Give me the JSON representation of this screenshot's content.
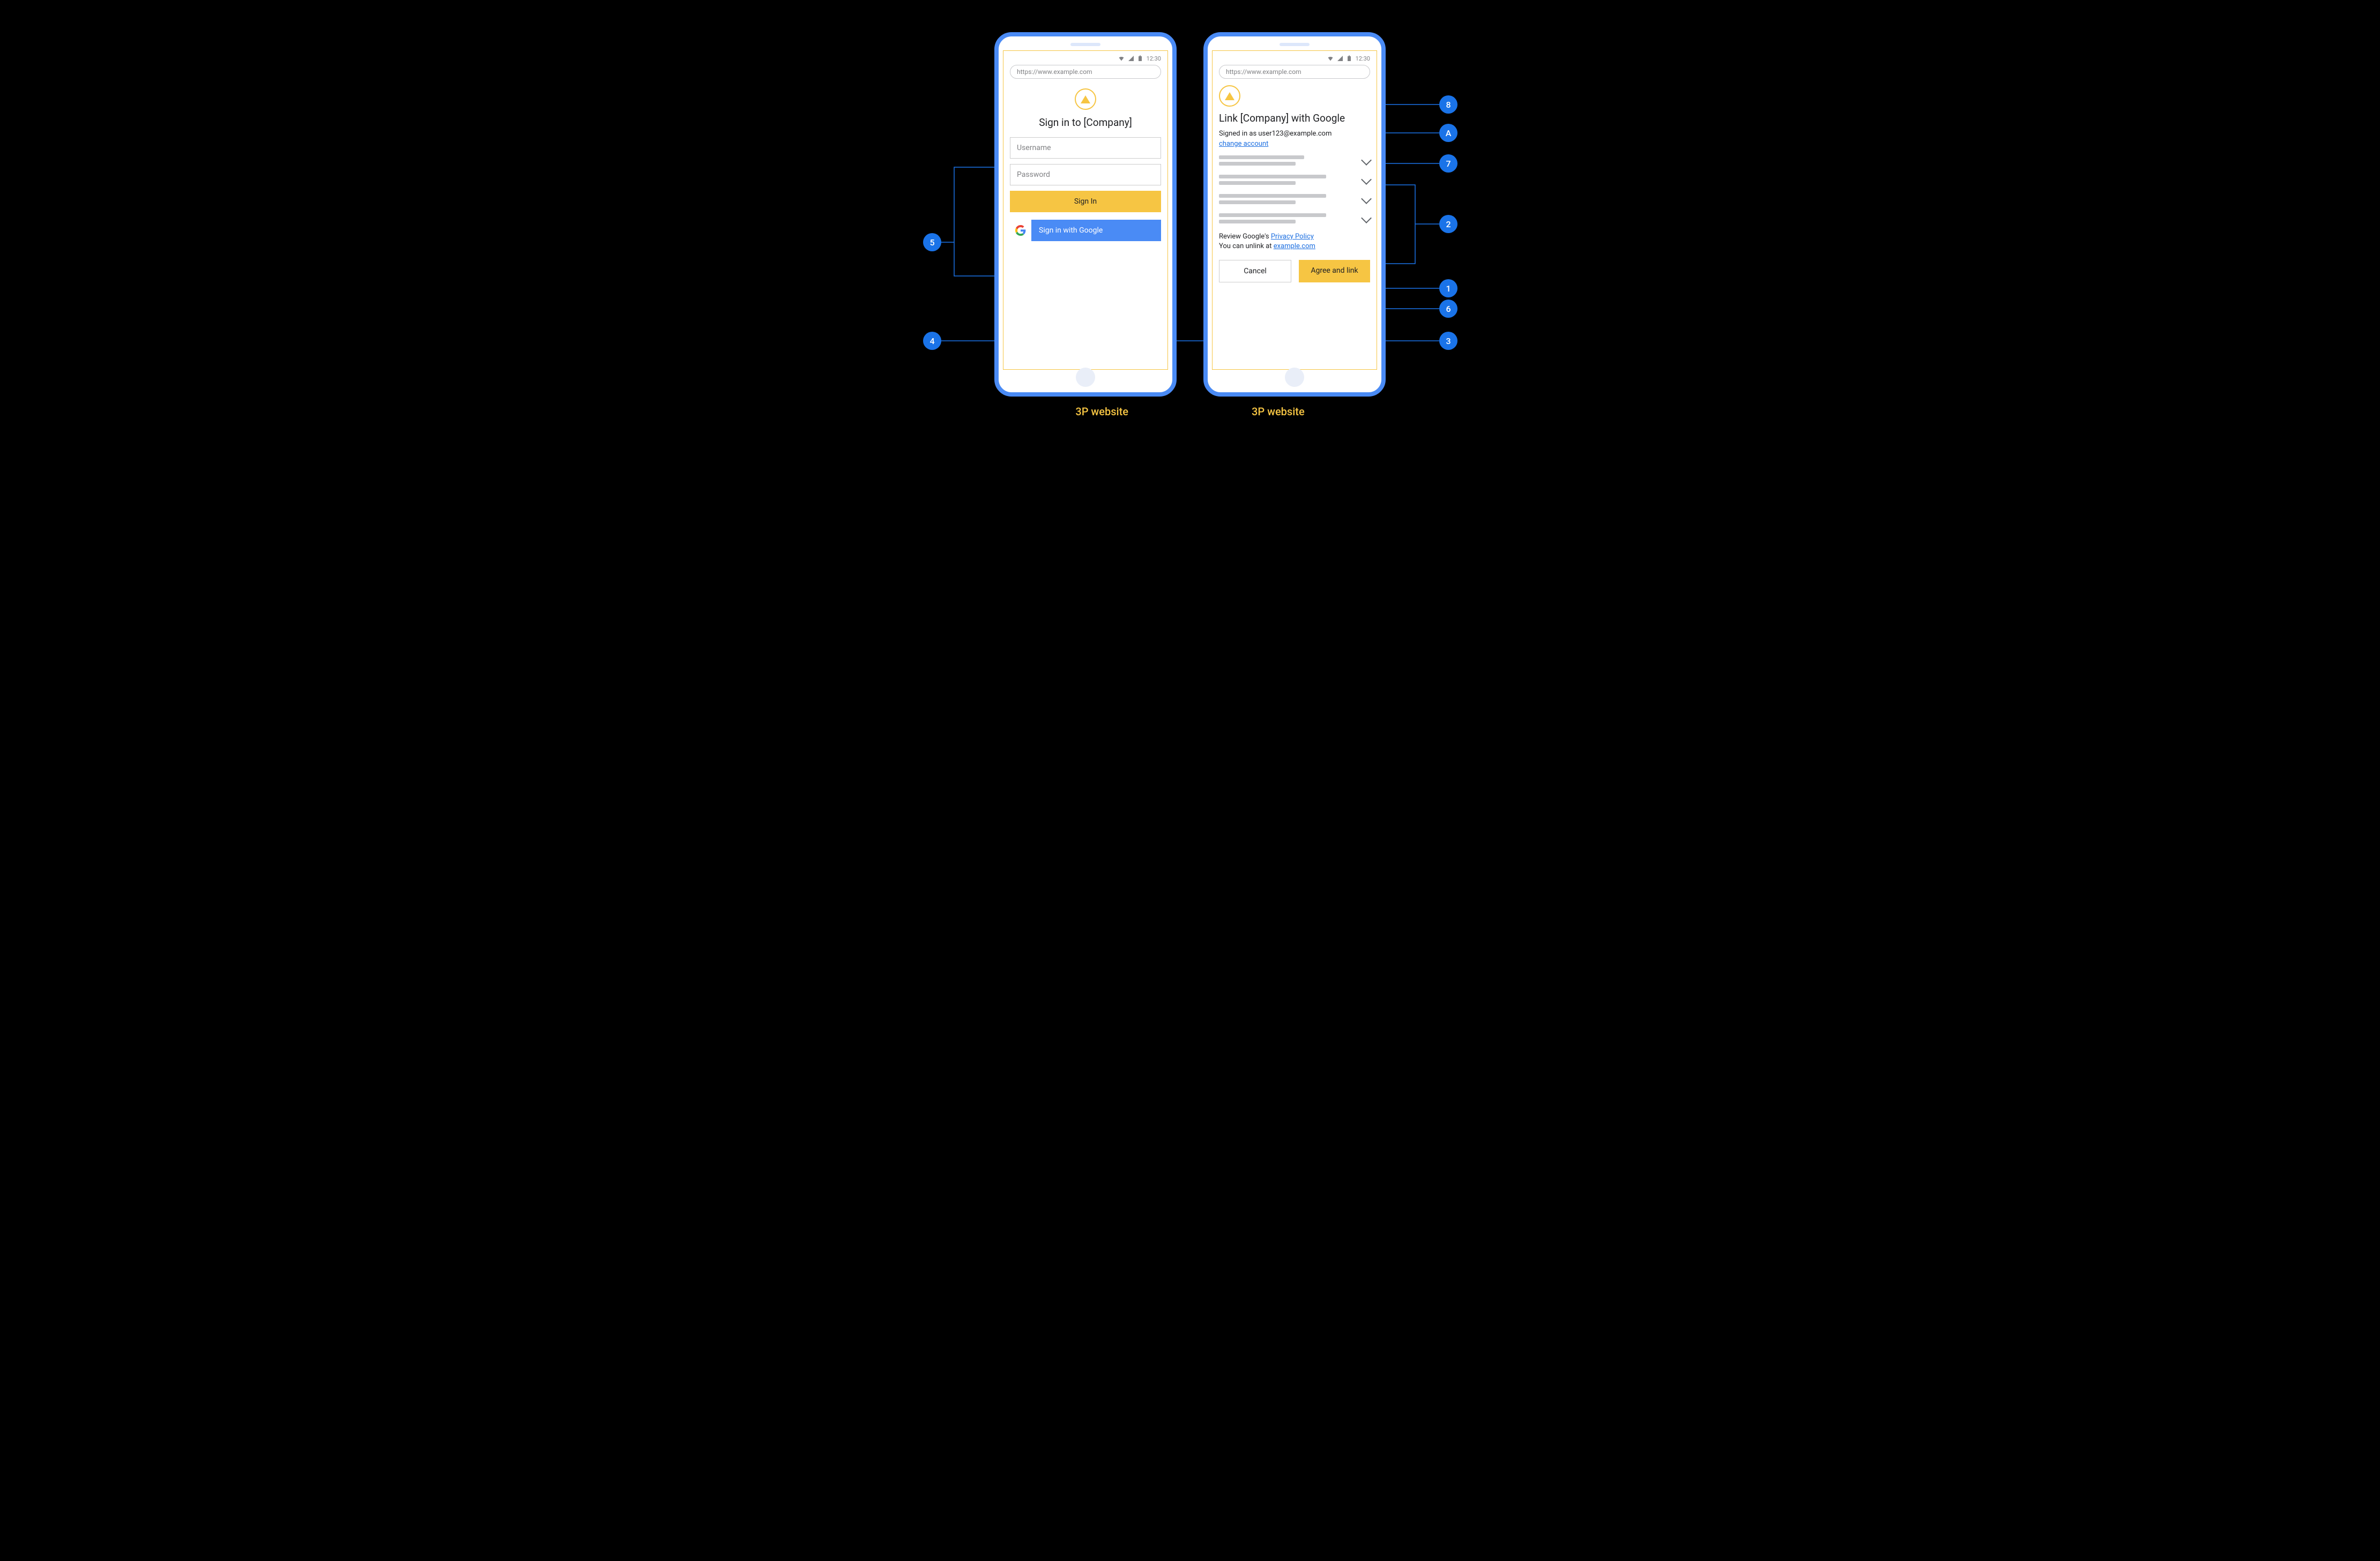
{
  "statusbar": {
    "time": "12:30"
  },
  "url": "https://www.example.com",
  "phone1": {
    "title": "Sign in to [Company]",
    "username_placeholder": "Username",
    "password_placeholder": "Password",
    "signin_button": "Sign In",
    "google_button": "Sign in with Google"
  },
  "phone2": {
    "title": "Link [Company] with Google",
    "signed_in_prefix": "Signed in as ",
    "signed_in_email": "user123@example.com",
    "change_account": "change account",
    "review_prefix": "Review Google's ",
    "privacy_policy": "Privacy Policy",
    "unlink_prefix": "You can unlink at ",
    "unlink_domain": "example.com",
    "cancel": "Cancel",
    "agree": "Agree and link"
  },
  "callouts": {
    "c1": "1",
    "c2": "2",
    "c3": "3",
    "c4": "4",
    "c5": "5",
    "c6": "6",
    "c7": "7",
    "c8": "8",
    "cA": "A"
  },
  "captions": {
    "left": "3P website",
    "right": "3P website"
  }
}
